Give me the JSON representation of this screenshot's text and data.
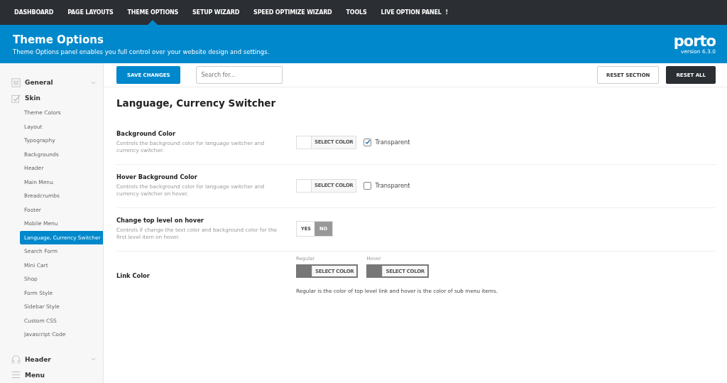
{
  "top_nav": [
    {
      "label": "DASHBOARD",
      "selected": false
    },
    {
      "label": "PAGE LAYOUTS",
      "selected": false
    },
    {
      "label": "THEME OPTIONS",
      "selected": true
    },
    {
      "label": "SETUP WIZARD",
      "selected": false
    },
    {
      "label": "SPEED OPTIMIZE WIZARD",
      "selected": false
    },
    {
      "label": "TOOLS",
      "selected": false
    },
    {
      "label": "LIVE OPTION PANEL",
      "selected": false,
      "badge": "!"
    }
  ],
  "header": {
    "title": "Theme Options",
    "subtitle": "Theme Options panel enables you full control over your website design and settings.",
    "logo": "porto",
    "version": "version 6.3.0"
  },
  "toolbar": {
    "save": "SAVE CHANGES",
    "search_placeholder": "Search for...",
    "reset_section": "RESET SECTION",
    "reset_all": "RESET ALL"
  },
  "sidebar": [
    {
      "label": "General",
      "expanded": false
    },
    {
      "label": "Skin",
      "expanded": true,
      "children": [
        {
          "label": "Theme Colors",
          "selected": false
        },
        {
          "label": "Layout",
          "selected": false
        },
        {
          "label": "Typography",
          "selected": false
        },
        {
          "label": "Backgrounds",
          "selected": false
        },
        {
          "label": "Header",
          "selected": false
        },
        {
          "label": "Main Menu",
          "selected": false
        },
        {
          "label": "Breadcrumbs",
          "selected": false
        },
        {
          "label": "Footer",
          "selected": false
        },
        {
          "label": "Mobile Menu",
          "selected": false
        },
        {
          "label": "Language, Currency Switcher",
          "selected": true
        },
        {
          "label": "Search Form",
          "selected": false
        },
        {
          "label": "Mini Cart",
          "selected": false
        },
        {
          "label": "Shop",
          "selected": false
        },
        {
          "label": "Form Style",
          "selected": false
        },
        {
          "label": "Sidebar Style",
          "selected": false
        },
        {
          "label": "Custom CSS",
          "selected": false
        },
        {
          "label": "Javascript Code",
          "selected": false
        }
      ]
    },
    {
      "label": "Header",
      "expanded": false
    },
    {
      "label": "Menu"
    }
  ],
  "section_title": "Language, Currency Switcher",
  "settings": [
    {
      "kind": "color",
      "title": "Background Color",
      "description": "Controls the background color for language switcher and currency switcher.",
      "swatch": {
        "color": "#ffffff",
        "button": "SELECT COLOR"
      },
      "transparent": {
        "label": "Transparent",
        "checked": true
      }
    },
    {
      "kind": "color",
      "title": "Hover Background Color",
      "description": "Controls the background color for language switcher and currency switcher on hover.",
      "swatch": {
        "color": "#ffffff",
        "button": "SELECT COLOR"
      },
      "transparent": {
        "label": "Transparent",
        "checked": false
      }
    },
    {
      "kind": "toggle",
      "title": "Change top level on hover",
      "description": "Controls if change the text color and background color for the first level item on hover.",
      "options": [
        {
          "label": "YES",
          "selected": false
        },
        {
          "label": "NO",
          "selected": true
        }
      ]
    },
    {
      "kind": "multicolor",
      "title": "Link Color",
      "swatches": [
        {
          "label": "Regular",
          "color": "#777777",
          "button": "SELECT COLOR"
        },
        {
          "label": "Hover",
          "color": "#777777",
          "button": "SELECT COLOR"
        }
      ],
      "note": "Regular is the color of top level link and hover is the color of sub menu items."
    }
  ]
}
